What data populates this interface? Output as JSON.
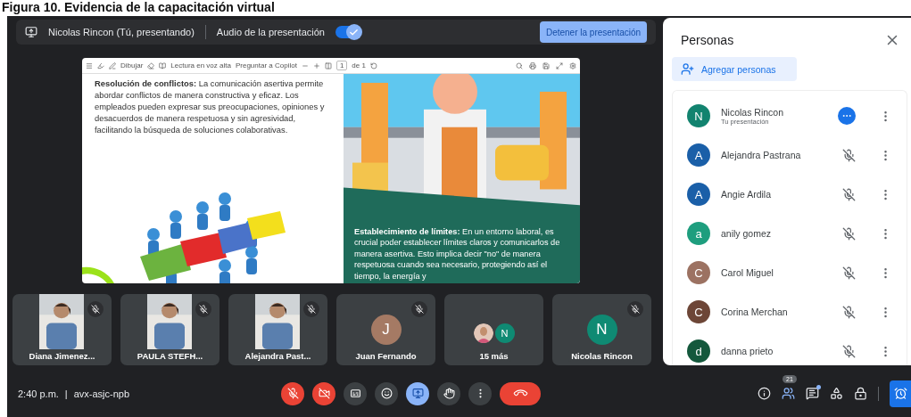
{
  "caption": "Figura 10. Evidencia de la capacitación virtual",
  "presenting_bar": {
    "presenter": "Nicolas Rincon (Tú, presentando)",
    "audio_label": "Audio de la presentación",
    "audio_on": true,
    "stop_button": "Detener la presentación"
  },
  "viewer_toolbar": {
    "draw": "Dibujar",
    "read_aloud": "Lectura en voz alta",
    "copilot": "Preguntar a Copilot",
    "page": "1",
    "page_total": "de 1"
  },
  "slide": {
    "left_text": "**Resolución de conflictos:** La comunicación asertiva permite abordar conflictos de manera constructiva y eficaz. Los empleados pueden expresar sus preocupaciones, opiniones y desacuerdos de manera respetuosa y sin agresividad, facilitando la búsqueda de soluciones colaborativas.",
    "right_text": "**Establecimiento de límites:** En un entorno laboral, es crucial poder establecer límites claros y comunicarlos de manera asertiva. Esto implica decir \"no\" de manera respetuosa cuando sea necesario, protegiendo así el tiempo, la energía y"
  },
  "tiles": [
    {
      "kind": "camera",
      "name": "Diana Jimenez...",
      "muted": true
    },
    {
      "kind": "camera",
      "name": "PAULA STEFH...",
      "muted": true
    },
    {
      "kind": "camera",
      "name": "Alejandra Past...",
      "muted": true
    },
    {
      "kind": "avatar",
      "name": "Juan Fernando",
      "initial": "J",
      "color": "#a57a64",
      "muted": true
    },
    {
      "kind": "more",
      "name": "15 más",
      "initial": "N",
      "color": "#0f8a73",
      "muted": false
    },
    {
      "kind": "avatar",
      "name": "Nicolas Rincon",
      "initial": "N",
      "color": "#0f8a73",
      "muted": true
    }
  ],
  "people_panel": {
    "title": "Personas",
    "add_button": "Agregar personas",
    "participants": [
      {
        "name": "Nicolas Rincon",
        "subtitle": "Tu presentación",
        "initial": "N",
        "color": "#12836f",
        "kind": "presenting"
      },
      {
        "name": "Alejandra Pastrana",
        "initial": "A",
        "color": "#1a5fa8",
        "kind": "muted"
      },
      {
        "name": "Angie Ardila",
        "initial": "A",
        "color": "#1a5fa8",
        "kind": "muted"
      },
      {
        "name": "anily gomez",
        "initial": "a",
        "color": "#1e9e7e",
        "kind": "muted"
      },
      {
        "name": "Carol Miguel",
        "initial": "C",
        "color": "#9c7262",
        "kind": "muted"
      },
      {
        "name": "Corina Merchan",
        "initial": "C",
        "color": "#6d4637",
        "kind": "muted"
      },
      {
        "name": "danna prieto",
        "initial": "d",
        "color": "#14583c",
        "kind": "muted"
      }
    ]
  },
  "bottom_bar": {
    "time": "2:40 p.m.",
    "separator": "|",
    "meeting_code": "avx-asjc-npb",
    "mic_on": false,
    "camera_on": false,
    "people_count": "21"
  }
}
